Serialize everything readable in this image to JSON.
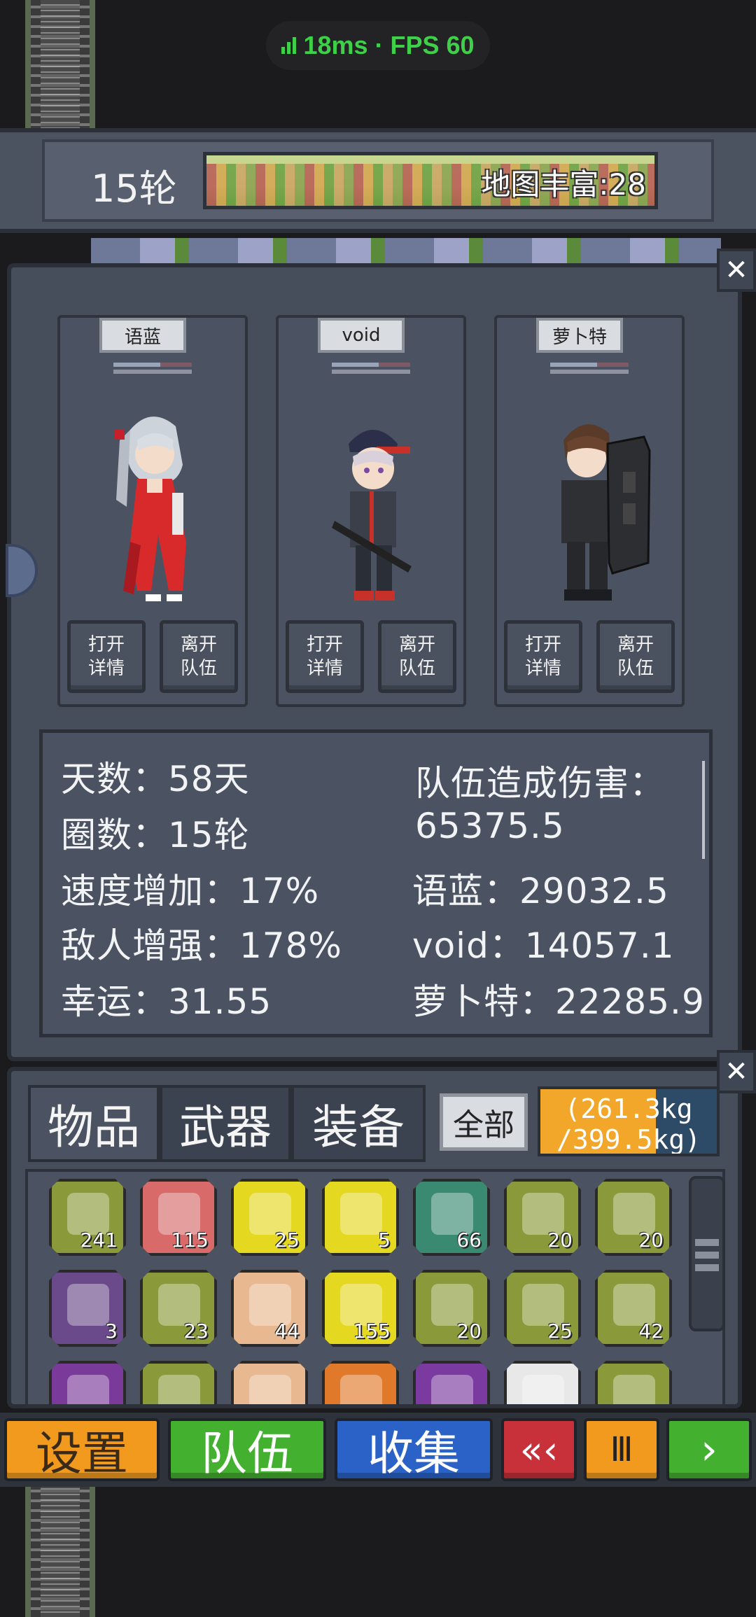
{
  "status": {
    "latency": "18ms · FPS 60",
    "color": "#3fd04a"
  },
  "hud": {
    "round": "15轮",
    "map_label": "地图丰富:28"
  },
  "team": {
    "members": [
      {
        "name": "语蓝",
        "detail_label": "打开\n详情",
        "leave_label": "离开\n队伍",
        "sprite": "silver-hair-red-dress-girl"
      },
      {
        "name": "void",
        "detail_label": "打开\n详情",
        "leave_label": "离开\n队伍",
        "sprite": "cap-boy-with-rifle"
      },
      {
        "name": "萝卜特",
        "detail_label": "打开\n详情",
        "leave_label": "离开\n队伍",
        "sprite": "armored-soldier-with-shield"
      }
    ]
  },
  "stats": {
    "days": "天数：58天",
    "rounds": "圈数：15轮",
    "speed": "速度增加：17%",
    "enemy": "敌人增强：178%",
    "luck": "幸运：31.55",
    "team_damage_title": "队伍造成伤害：",
    "team_damage_value": "65375.5",
    "dmg_1": "语蓝：29032.5",
    "dmg_2": "void：14057.1",
    "dmg_3": "萝卜特：22285.9"
  },
  "inventory": {
    "tabs": [
      "物品",
      "武器",
      "装备"
    ],
    "all_label": "全部",
    "weight_line1": "(261.3kg",
    "weight_line2": "/399.5kg)",
    "weight_fraction": 0.654,
    "items": [
      {
        "icon": "drinks-icon",
        "count": "241",
        "bg": "#8a9a3a"
      },
      {
        "icon": "first-aid-icon",
        "count": "115",
        "bg": "#d86a6a"
      },
      {
        "icon": "syringe-icon",
        "count": "25",
        "bg": "#e4d820"
      },
      {
        "icon": "bottle-icon",
        "count": "5",
        "bg": "#e4d820"
      },
      {
        "icon": "log-icon",
        "count": "66",
        "bg": "#3a8a72"
      },
      {
        "icon": "egg-icon",
        "count": "20",
        "bg": "#8a9a3a"
      },
      {
        "icon": "herb-icon",
        "count": "20",
        "bg": "#8a9a3a"
      },
      {
        "icon": "blueprint-icon",
        "count": "3",
        "bg": "#6a4a8a"
      },
      {
        "icon": "meat-can-icon",
        "count": "23",
        "bg": "#8a9a3a"
      },
      {
        "icon": "stone-icon",
        "count": "44",
        "bg": "#e8b890"
      },
      {
        "icon": "map-icon",
        "count": "155",
        "bg": "#e4d820"
      },
      {
        "icon": "chili-icon",
        "count": "20",
        "bg": "#8a9a3a"
      },
      {
        "icon": "cloth-icon",
        "count": "25",
        "bg": "#8a9a3a"
      },
      {
        "icon": "steak-icon",
        "count": "42",
        "bg": "#8a9a3a"
      },
      {
        "icon": "shirt-icon",
        "count": "",
        "bg": "#7a3a9a"
      },
      {
        "icon": "apple-icon",
        "count": "",
        "bg": "#8a9a3a"
      },
      {
        "icon": "wire-icon",
        "count": "",
        "bg": "#e8b890"
      },
      {
        "icon": "tool-icon",
        "count": "",
        "bg": "#e07a2a"
      },
      {
        "icon": "mask-icon",
        "count": "",
        "bg": "#7a3aa0"
      },
      {
        "icon": "scroll-icon",
        "count": "",
        "bg": "#e8e8e8"
      },
      {
        "icon": "jar-icon",
        "count": "",
        "bg": "#8a9a3a"
      }
    ]
  },
  "bottom": {
    "settings": "设置",
    "team": "队伍",
    "collect": "收集",
    "rewind": "«‹",
    "pause": "Ⅲ",
    "next": "›",
    "colors": {
      "settings": "#f29a1e",
      "team": "#44b030",
      "collect": "#2a62c8",
      "rewind": "#c8303a",
      "pause": "#f29a1e",
      "next": "#44b030"
    }
  }
}
